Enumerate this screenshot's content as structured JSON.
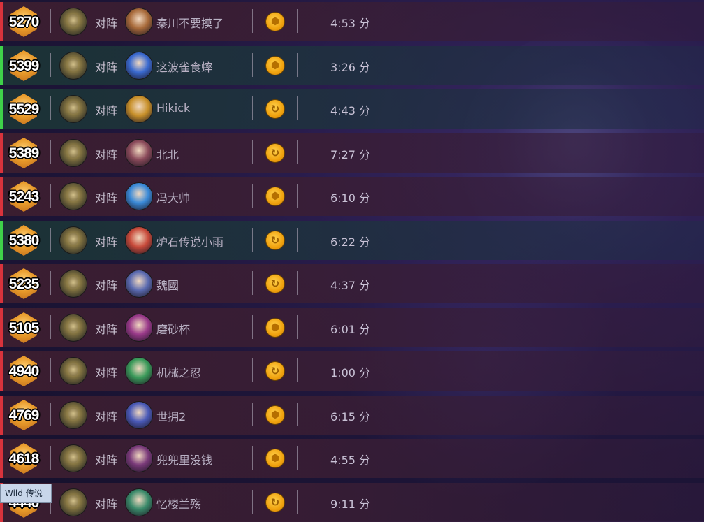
{
  "vs_label": "对阵",
  "tooltip": "Wild 传说",
  "colors": {
    "win_edge": "#3fd24a",
    "loss_edge": "#d8333c",
    "mode_gold": "#f0a20e"
  },
  "matches": [
    {
      "rank": "5270",
      "result": "loss",
      "opponent": "秦川不要摸了",
      "mode_icon": "standard-coin-icon",
      "duration": "4:53 分",
      "opp_color": "#a86a3a"
    },
    {
      "rank": "5399",
      "result": "win",
      "opponent": "这波雀食蟀",
      "mode_icon": "standard-coin-icon",
      "duration": "3:26 分",
      "opp_color": "#3a6ad0"
    },
    {
      "rank": "5529",
      "result": "win",
      "opponent": "Hikick",
      "mode_icon": "wild-swirl-icon",
      "duration": "4:43 分",
      "opp_color": "#c8902a"
    },
    {
      "rank": "5389",
      "result": "loss",
      "opponent": "北北",
      "mode_icon": "wild-swirl-icon",
      "duration": "7:27 分",
      "opp_color": "#8a4a5a"
    },
    {
      "rank": "5243",
      "result": "loss",
      "opponent": "冯大帅",
      "mode_icon": "standard-coin-icon",
      "duration": "6:10 分",
      "opp_color": "#3a8ad8"
    },
    {
      "rank": "5380",
      "result": "win",
      "opponent": "炉石传说小雨",
      "mode_icon": "wild-swirl-icon",
      "duration": "6:22 分",
      "opp_color": "#c84a3a"
    },
    {
      "rank": "5235",
      "result": "loss",
      "opponent": "魏國",
      "mode_icon": "wild-swirl-icon",
      "duration": "4:37 分",
      "opp_color": "#5a6ab0"
    },
    {
      "rank": "5105",
      "result": "loss",
      "opponent": "磨砂杯",
      "mode_icon": "standard-coin-icon",
      "duration": "6:01 分",
      "opp_color": "#9a3a8a"
    },
    {
      "rank": "4940",
      "result": "loss",
      "opponent": "机械之忍",
      "mode_icon": "wild-swirl-icon",
      "duration": "1:00 分",
      "opp_color": "#3a9a5a"
    },
    {
      "rank": "4769",
      "result": "loss",
      "opponent": "世拥2",
      "mode_icon": "standard-coin-icon",
      "duration": "6:15 分",
      "opp_color": "#4a5ab8"
    },
    {
      "rank": "4618",
      "result": "loss",
      "opponent": "兜兜里没钱",
      "mode_icon": "standard-coin-icon",
      "duration": "4:55 分",
      "opp_color": "#7a3a7a"
    },
    {
      "rank": "4440",
      "result": "loss",
      "opponent": "忆楼兰殇",
      "mode_icon": "wild-swirl-icon",
      "duration": "9:11 分",
      "opp_color": "#3a8a6a"
    }
  ]
}
